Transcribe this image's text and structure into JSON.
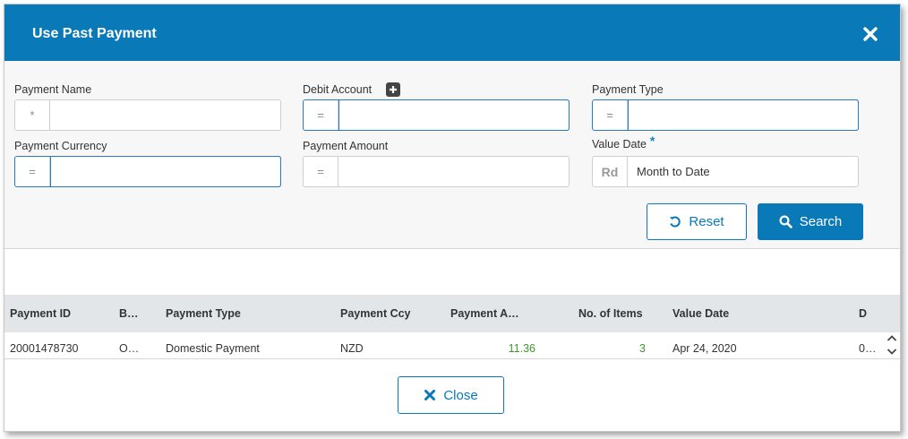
{
  "dialog": {
    "title": "Use Past Payment"
  },
  "filters": {
    "payment_name": {
      "label": "Payment Name",
      "operator": "*",
      "value": ""
    },
    "debit_account": {
      "label": "Debit Account",
      "operator": "=",
      "value": ""
    },
    "payment_type": {
      "label": "Payment Type",
      "operator": "=",
      "value": ""
    },
    "payment_currency": {
      "label": "Payment Currency",
      "operator": "=",
      "value": ""
    },
    "payment_amount": {
      "label": "Payment Amount",
      "operator": "=",
      "value": ""
    },
    "value_date": {
      "label": "Value Date",
      "required_mark": "*",
      "operator": "Rd",
      "value": "Month to Date"
    }
  },
  "buttons": {
    "reset_label": "Reset",
    "search_label": "Search",
    "close_label": "Close"
  },
  "table": {
    "columns": [
      "Payment ID",
      "B…",
      "Payment Type",
      "Payment Ccy",
      "Payment A…",
      "No. of Items",
      "Value Date",
      "D"
    ],
    "rows": [
      [
        "20001478730",
        "O…",
        "Domestic Payment",
        "NZD",
        "11.36",
        "3",
        "Apr 24, 2020",
        "0…"
      ]
    ]
  },
  "colors": {
    "header": "#0a79b8",
    "accent": "#0a79b8",
    "amount_text": "#3a9a2a"
  },
  "icons": [
    "close-icon",
    "plus-icon",
    "reset-icon",
    "search-icon",
    "chevron-up-icon",
    "chevron-down-icon"
  ]
}
